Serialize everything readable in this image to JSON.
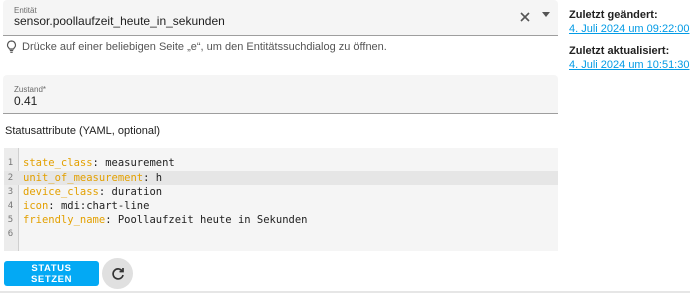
{
  "entity": {
    "label": "Entität",
    "value": "sensor.poollaufzeit_heute_in_sekunden"
  },
  "hint": {
    "text": "Drücke auf einer beliebigen Seite „e“, um den Entitätssuchdialog zu öffnen."
  },
  "state": {
    "label": "Zustand*",
    "value": "0.41"
  },
  "attributes": {
    "title": "Statusattribute (YAML, optional)",
    "lines": [
      {
        "num": "1",
        "key": "state_class",
        "value": "measurement"
      },
      {
        "num": "2",
        "key": "unit_of_measurement",
        "value": "h"
      },
      {
        "num": "3",
        "key": "device_class",
        "value": "duration"
      },
      {
        "num": "4",
        "key": "icon",
        "value": "mdi:chart-line"
      },
      {
        "num": "5",
        "key": "friendly_name",
        "value": "Poollaufzeit heute in Sekunden"
      },
      {
        "num": "6",
        "key": "",
        "value": ""
      }
    ]
  },
  "actions": {
    "set_state_label": "STATUS SETZEN",
    "refresh_icon": "refresh-icon"
  },
  "sidebar": {
    "last_changed_label": "Zuletzt geändert:",
    "last_changed_value": "4. Juli 2024 um 09:22:00",
    "last_updated_label": "Zuletzt aktualisiert:",
    "last_updated_value": "4. Juli 2024 um 10:51:30"
  },
  "colors": {
    "accent": "#03a9f4",
    "yaml_key": "#e3a000",
    "link": "#039be5"
  }
}
